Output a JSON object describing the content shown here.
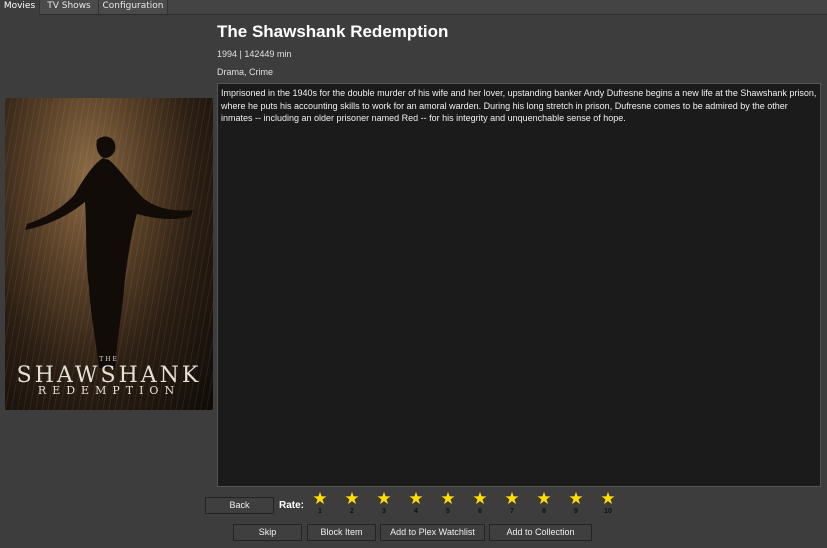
{
  "tabs": [
    {
      "label": "Movies",
      "active": true
    },
    {
      "label": "TV Shows",
      "active": false
    },
    {
      "label": "Configuration",
      "active": false
    }
  ],
  "movie": {
    "title": "The Shawshank Redemption",
    "meta": "1994 | 142449 min",
    "genres": "Drama, Crime",
    "overview": "Imprisoned in the 1940s for the double murder of his wife and her lover, upstanding banker Andy Dufresne begins a new life at the Shawshank prison, where he puts his accounting skills to work for an amoral warden. During his long stretch in prison, Dufresne comes to be admired by the other inmates -- including an older prisoner named Red -- for his integrity and unquenchable sense of hope.",
    "poster": {
      "line1": "THE",
      "line2": "SHAWSHANK",
      "line3": "REDEMPTION"
    }
  },
  "rating": {
    "label": "Rate:",
    "star_icon": "star-icon",
    "star_color": "#ffdd00",
    "stars": [
      "1",
      "2",
      "3",
      "4",
      "5",
      "6",
      "7",
      "8",
      "9",
      "10"
    ]
  },
  "buttons": {
    "back": "Back",
    "skip": "Skip",
    "block": "Block Item",
    "watchlist": "Add to Plex Watchlist",
    "collection": "Add to Collection"
  }
}
